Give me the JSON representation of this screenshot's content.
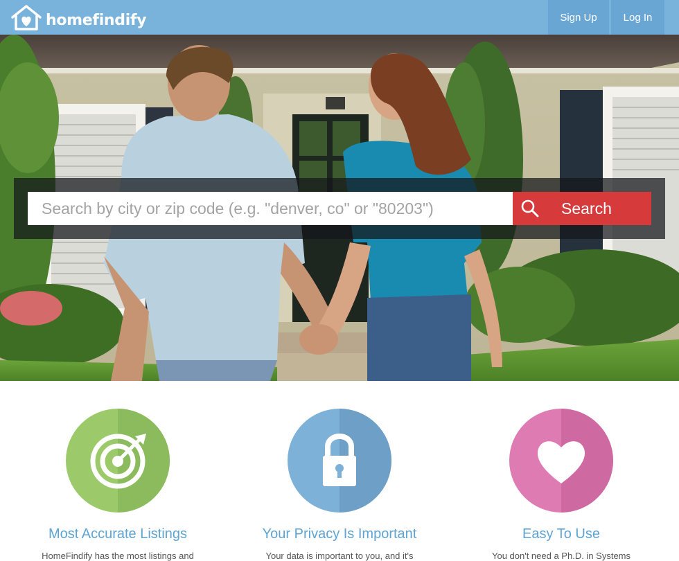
{
  "brand": {
    "name": "homefindify",
    "icon": "house-heart-icon"
  },
  "nav": {
    "signup": "Sign Up",
    "login": "Log In"
  },
  "search": {
    "placeholder": "Search by city or zip code (e.g. \"denver, co\" or \"80203\")",
    "button_label": "Search",
    "button_icon": "search-icon"
  },
  "features": [
    {
      "title": "Most Accurate Listings",
      "description": "HomeFindify has the most listings and",
      "icon": "target-icon",
      "color": "#9cca6a"
    },
    {
      "title": "Your Privacy Is Important",
      "description": "Your data is important to you, and it's",
      "icon": "lock-icon",
      "color": "#7db1d8"
    },
    {
      "title": "Easy To Use",
      "description": "You don't need a Ph.D. in Systems",
      "icon": "heart-icon",
      "color": "#df7bb3"
    }
  ],
  "colors": {
    "nav": "#79b3dc",
    "accent": "#d63a3a",
    "title": "#5ea4d3"
  }
}
